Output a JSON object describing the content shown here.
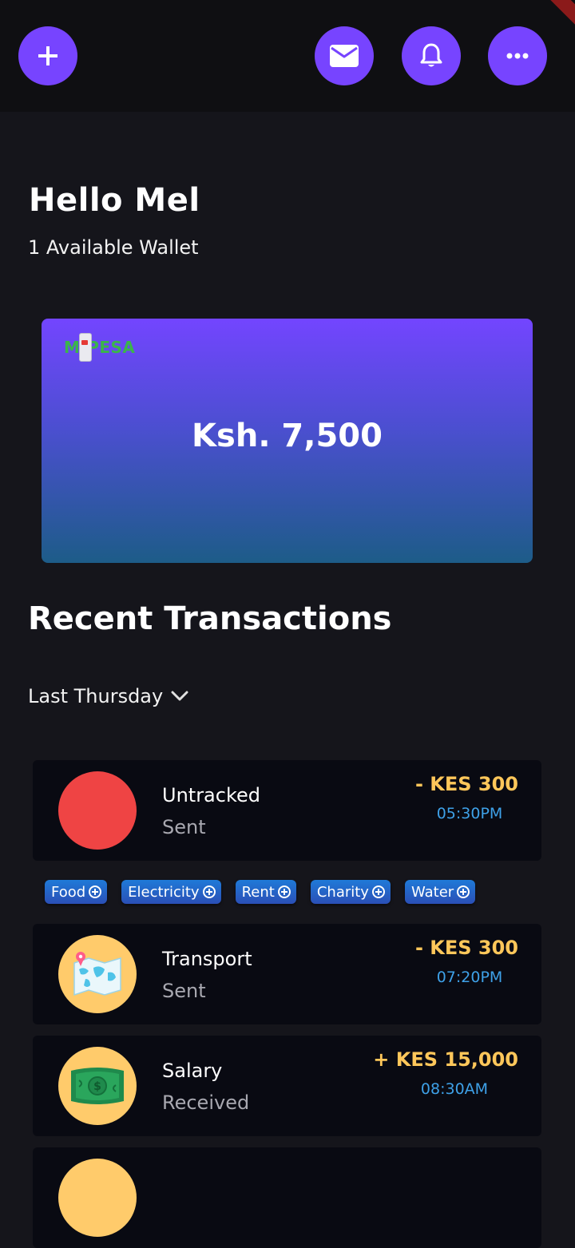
{
  "header": {
    "add_icon": "plus-icon",
    "mail_icon": "mail-icon",
    "notifications_icon": "bell-icon",
    "more_icon": "more-horizontal-icon",
    "accent_color": "#7744ff"
  },
  "greeting": {
    "title": "Hello Mel",
    "wallet_count": "1 Available Wallet"
  },
  "wallet": {
    "provider_logo": "M-PESA",
    "balance": "Ksh. 7,500"
  },
  "transactions": {
    "section_title": "Recent Transactions",
    "filter_label": "Last Thursday",
    "items": [
      {
        "title": "Untracked",
        "status": "Sent",
        "amount": "- KES 300",
        "time": "05:30PM",
        "avatar_color": "#ef4444",
        "icon": "untracked-circle"
      },
      {
        "title": "Transport",
        "status": "Sent",
        "amount": "- KES 300",
        "time": "07:20PM",
        "avatar_color": "#ffcb6b",
        "icon": "map-pin-icon"
      },
      {
        "title": "Salary",
        "status": "Received",
        "amount": "+ KES 15,000",
        "time": "08:30AM",
        "avatar_color": "#ffcb6b",
        "icon": "money-icon"
      }
    ]
  },
  "categories": [
    {
      "label": "Food"
    },
    {
      "label": "Electricity"
    },
    {
      "label": "Rent"
    },
    {
      "label": "Charity"
    },
    {
      "label": "Water"
    }
  ],
  "colors": {
    "background": "#15151b",
    "card": "#090a12",
    "amount": "#ffc75a",
    "time": "#3ea1e8"
  }
}
